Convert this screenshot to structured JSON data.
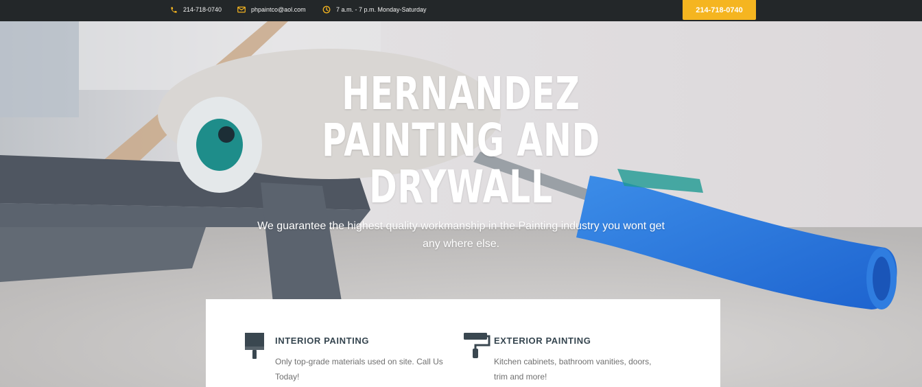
{
  "topbar": {
    "phone": "214-718-0740",
    "email": "phpaintco@aol.com",
    "hours": "7 a.m. - 7 p.m. Monday-Saturday",
    "cta_label": "214-718-0740",
    "accent_color": "#f5b520",
    "phone_icon": "phone-icon",
    "email_icon": "envelope-icon",
    "hours_icon": "clock-icon"
  },
  "hero": {
    "title_line1": "HERNANDEZ",
    "title_line2": "PAINTING AND",
    "title_line3": "DRYWALL",
    "subtitle": "We guarantee the highest quality workmanship in the Painting industry you wont get any where else."
  },
  "services": [
    {
      "icon": "paint-brush-icon",
      "title": "INTERIOR PAINTING",
      "text": "Only top-grade materials used on site. Call Us Today!"
    },
    {
      "icon": "paint-roller-icon",
      "title": "EXTERIOR PAINTING",
      "text": "Kitchen cabinets, bathroom vanities, doors, trim and more!"
    }
  ]
}
